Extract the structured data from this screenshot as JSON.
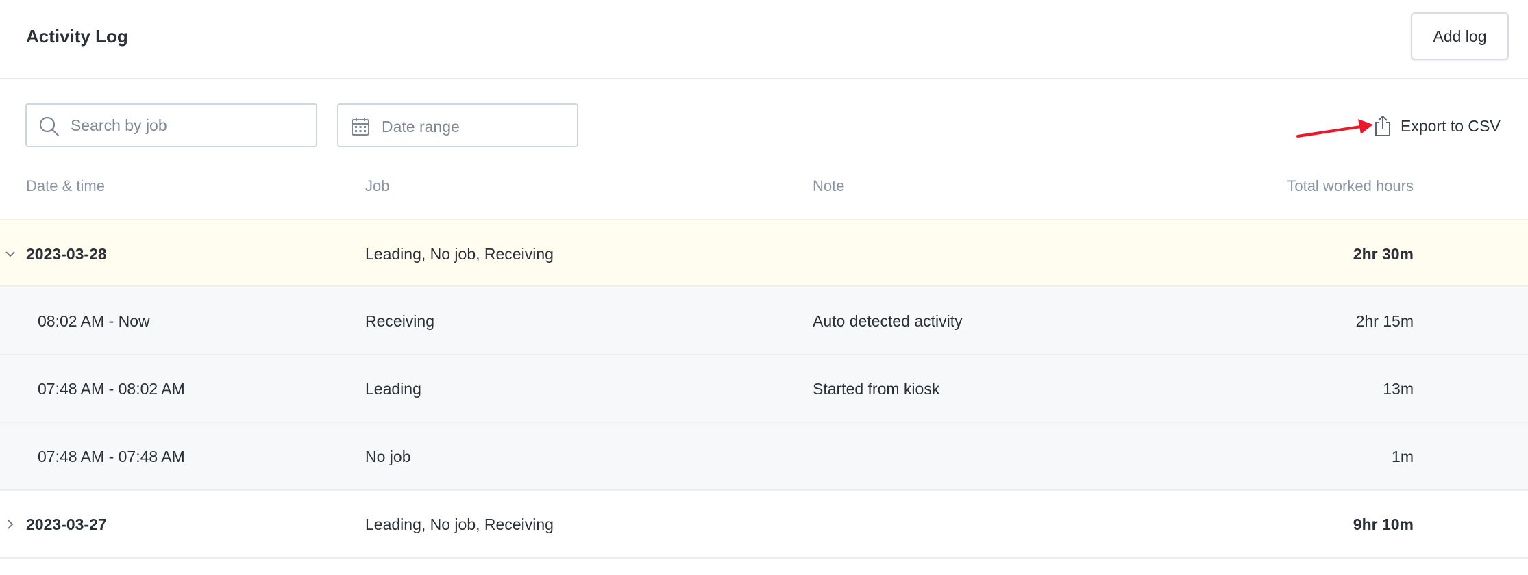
{
  "header": {
    "title": "Activity Log",
    "add_log_label": "Add log"
  },
  "filters": {
    "search_placeholder": "Search by job",
    "date_range_label": "Date range",
    "export_label": "Export to CSV"
  },
  "table": {
    "columns": [
      "Date & time",
      "Job",
      "Note",
      "Total worked hours"
    ],
    "groups": [
      {
        "date": "2023-03-28",
        "jobs": "Leading, No job, Receiving",
        "total": "2hr 30m",
        "expanded": true,
        "entries": [
          {
            "time": "08:02 AM - Now",
            "job": "Receiving",
            "note": "Auto detected activity",
            "hours": "2hr 15m"
          },
          {
            "time": "07:48 AM - 08:02 AM",
            "job": "Leading",
            "note": "Started from kiosk",
            "hours": "13m"
          },
          {
            "time": "07:48 AM - 07:48 AM",
            "job": "No job",
            "note": "",
            "hours": "1m"
          }
        ]
      },
      {
        "date": "2023-03-27",
        "jobs": "Leading, No job, Receiving",
        "total": "9hr 10m",
        "expanded": false,
        "entries": []
      }
    ]
  },
  "colors": {
    "annotation_arrow": "#e8192c",
    "expanded_row_bg": "#fffdf0",
    "child_row_bg": "#f7f8fa",
    "muted_text": "#8a93a3"
  },
  "icons": {
    "search": "search-icon",
    "calendar": "calendar-icon",
    "export": "share-upload-icon",
    "expanded": "chevron-down-icon",
    "collapsed": "chevron-right-icon"
  }
}
